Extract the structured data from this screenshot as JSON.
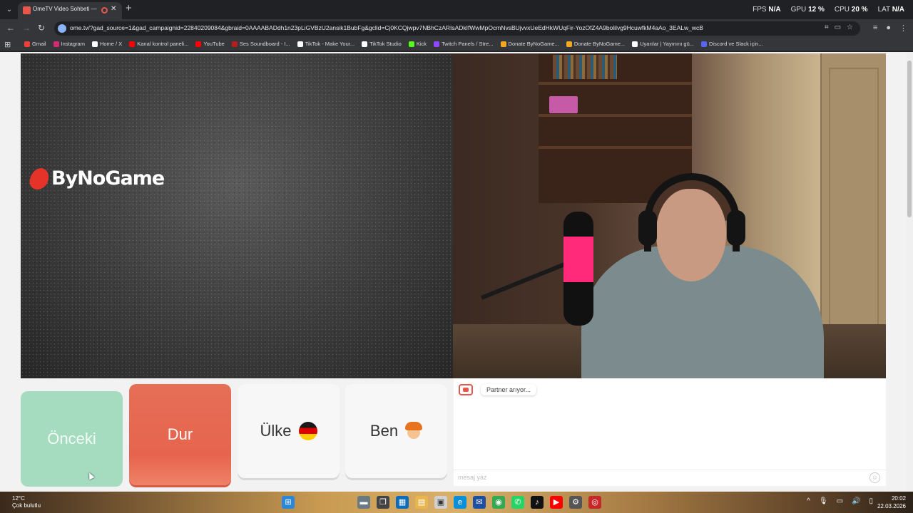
{
  "browser": {
    "tab": {
      "title": "OmeTV Video Sohbeti — O"
    },
    "stats": [
      {
        "label": "FPS",
        "value": "N/A"
      },
      {
        "label": "GPU",
        "value": "12 %"
      },
      {
        "label": "CPU",
        "value": "20 %"
      },
      {
        "label": "LAT",
        "value": "N/A"
      }
    ],
    "url": "ome.tv/?gad_source=1&gad_campaignid=22840209084&gbraid=0AAAABADdh1n23pLiGVBzU2ansik1BubFg&gclid=Cj0KCQjwpv7NBhCzARIsADkIfWwMpOcmNvsBUjvvxUeEdHkWUqFir-YozOfZ4A9bolilvg9HcuwfkM4aAo_3EALw_wcB",
    "bookmarks": [
      {
        "label": "Gmail",
        "color": "#ea4335"
      },
      {
        "label": "Instagram",
        "color": "#d62976"
      },
      {
        "label": "Home / X",
        "color": "#ffffff"
      },
      {
        "label": "Kanal kontrol paneli...",
        "color": "#ff0000"
      },
      {
        "label": "YouTube",
        "color": "#ff0000"
      },
      {
        "label": "Ses Soundboard - I...",
        "color": "#b71c1c"
      },
      {
        "label": "TikTok - Make Your...",
        "color": "#ffffff"
      },
      {
        "label": "TikTok Studio",
        "color": "#ffffff"
      },
      {
        "label": "Kick",
        "color": "#53fc18"
      },
      {
        "label": "Twitch Panels / Stre...",
        "color": "#9146ff"
      },
      {
        "label": "Donate ByNoGame...",
        "color": "#f5a623"
      },
      {
        "label": "Donate ByNoGame...",
        "color": "#f5a623"
      },
      {
        "label": "Uyarılar | Yayınını gü...",
        "color": "#ffffff"
      },
      {
        "label": "Discord ve Slack için...",
        "color": "#5865f2"
      }
    ]
  },
  "page": {
    "brand": "ByNoGame",
    "buttons": {
      "prev": "Önceki",
      "stop": "Dur",
      "country": "Ülke",
      "me": "Ben"
    },
    "chat": {
      "status": "Partner arıyor...",
      "placeholder": "mesaj yaz"
    }
  },
  "taskbar": {
    "weather_temp": "12°C",
    "weather_desc": "Çok bulutlu",
    "time": "20:02",
    "date": "22.03.2026"
  }
}
